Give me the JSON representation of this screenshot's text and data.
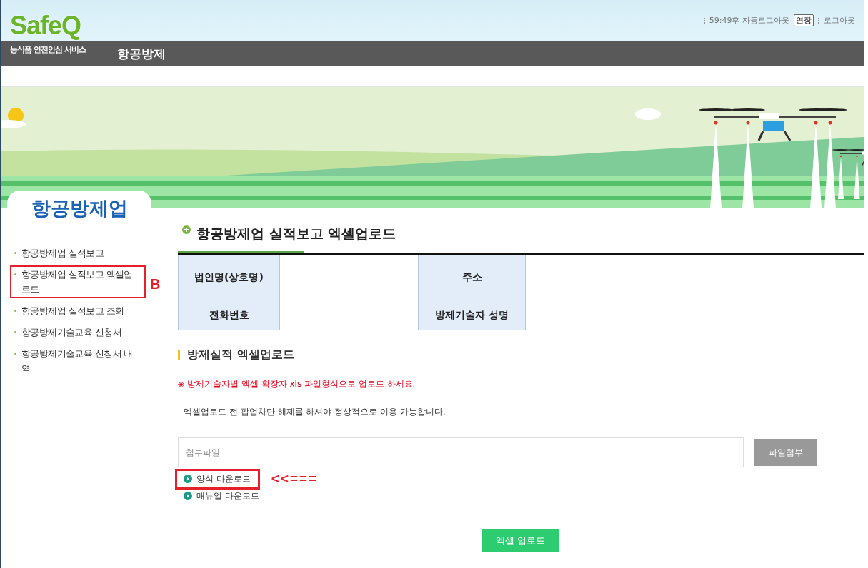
{
  "logo": {
    "name": "SafeQ",
    "subtitle": "농식품 안전안심 서비스"
  },
  "top_links": {
    "timer": "59:49후 자동로그아웃",
    "extend_button": "연장",
    "logout": "로그아웃"
  },
  "nav": {
    "title": "항공방제"
  },
  "sidebar": {
    "title": "항공방제업",
    "items": [
      {
        "label": "항공방제업 실적보고",
        "highlighted": false
      },
      {
        "label": "항공방제업 실적보고 엑셀업로드",
        "highlighted": true
      },
      {
        "label": "항공방제업 실적보고 조회",
        "highlighted": false
      },
      {
        "label": "항공방제기술교육 신청서",
        "highlighted": false
      },
      {
        "label": "항공방제기술교육 신청서 내역",
        "highlighted": false
      }
    ]
  },
  "annotation_label": "B",
  "page_title": "항공방제업 실적보고 엑셀업로드",
  "info_table": {
    "rows": [
      [
        {
          "label": "법인명(상호명)"
        },
        {
          "label": "주소"
        }
      ],
      [
        {
          "label": "전화번호"
        },
        {
          "label": "방제기술자 성명"
        }
      ]
    ]
  },
  "section_title": "방제실적 엑셀업로드",
  "notice": "◈ 방제기술자별 엑셀 확장자 xls 파일형식으로 업로드 하세요.",
  "note": "- 엑셀업로드 전 팝업차단 해제를 하셔야 정상적으로 이용 가능합니다.",
  "file_field": {
    "placeholder": "첨부파일"
  },
  "attach_button": "파일첨부",
  "downloads": [
    {
      "label": "양식 다운로드",
      "highlighted": true
    },
    {
      "label": "매뉴얼 다운로드",
      "highlighted": false
    }
  ],
  "annotation_arrow": "<<===",
  "upload_button": "엑셀 업로드"
}
